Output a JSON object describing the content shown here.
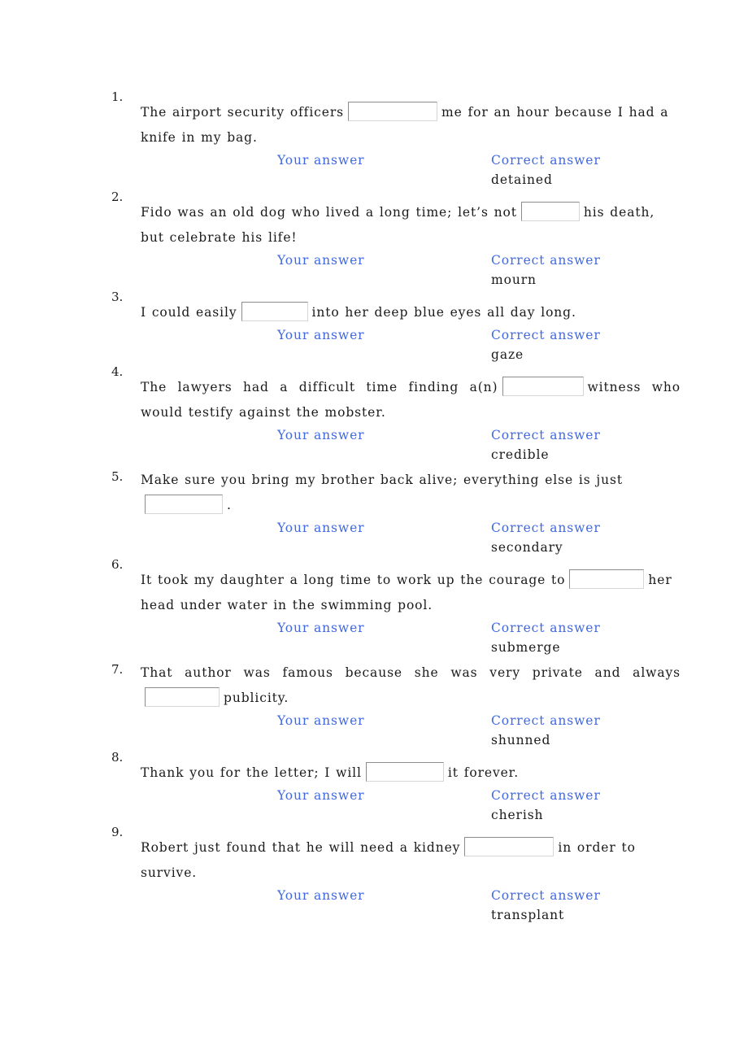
{
  "labels": {
    "your_answer": "Your answer",
    "correct_answer": "Correct answer",
    "blank_placeholder": ""
  },
  "colors": {
    "label_blue": "#4169E1",
    "text": "#1A1A1A",
    "box_border_dark": "#8C8C8C",
    "box_border_light": "#D6D6D6",
    "background": "#FFFFFF"
  },
  "questions": [
    {
      "number": "1.",
      "before": "The airport security officers",
      "after": "me for an hour because I had a knife in my bag.",
      "your_answer_value": "",
      "correct_answer": "detained"
    },
    {
      "number": "2.",
      "before": "Fido was an old dog who lived a long time; let’s not",
      "after": "his death, but celebrate his life!",
      "your_answer_value": "",
      "correct_answer": "mourn"
    },
    {
      "number": "3.",
      "before": "I could easily",
      "after": "into her deep blue eyes all day long.",
      "your_answer_value": "",
      "correct_answer": "gaze"
    },
    {
      "number": "4.",
      "before": "The lawyers had a difficult time finding a(n)",
      "after": "witness who would testify against the mobster.",
      "your_answer_value": "",
      "correct_answer": "credible"
    },
    {
      "number": "5.",
      "before": "Make sure you bring my brother back alive; everything else is just",
      "after": ".",
      "your_answer_value": "",
      "correct_answer": "secondary"
    },
    {
      "number": "6.",
      "before": "It took my daughter a long time to work up the courage to",
      "after": "her head under water in the swimming pool.",
      "your_answer_value": "",
      "correct_answer": "submerge"
    },
    {
      "number": "7.",
      "before": "That author was famous because she was very private and always",
      "after": "publicity.",
      "your_answer_value": "",
      "correct_answer": "shunned"
    },
    {
      "number": "8.",
      "before": "Thank you for the letter; I will",
      "after": "it forever.",
      "your_answer_value": "",
      "correct_answer": "cherish"
    },
    {
      "number": "9.",
      "before": "Robert just found that he will need a kidney",
      "after": "in order to survive.",
      "your_answer_value": "",
      "correct_answer": "transplant"
    }
  ]
}
